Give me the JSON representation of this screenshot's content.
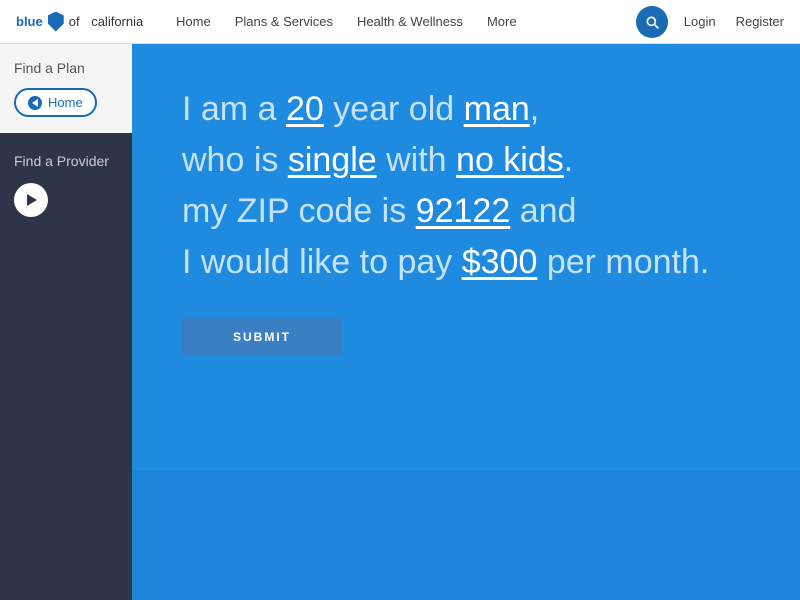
{
  "brand": {
    "text_blue": "blue",
    "text_of": "of",
    "text_california": "california"
  },
  "navbar": {
    "links": [
      "Home",
      "Plans & Services",
      "Health & Wellness",
      "More"
    ],
    "login": "Login",
    "register": "Register"
  },
  "sidebar": {
    "find_plan_label": "Find a Plan",
    "home_button": "Home",
    "find_provider_label": "Find a Provider"
  },
  "hero": {
    "line1_pre": "I am a",
    "age": "20",
    "line1_post": "year old",
    "gender": "man",
    "line2_pre": "who is",
    "status": "single",
    "line2_mid": "with",
    "kids": "no kids",
    "line3_pre": "my ZIP code is",
    "zip": "92122",
    "line3_post": "and",
    "line4_pre": "I would like to pay",
    "amount": "$300",
    "line4_post": "per month.",
    "submit_label": "SUBMIT"
  }
}
